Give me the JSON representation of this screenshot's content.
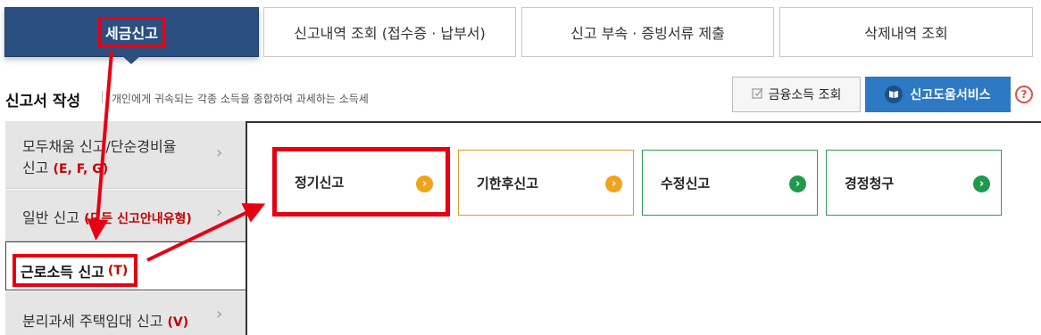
{
  "tabs": [
    {
      "label": "세금신고",
      "active": true
    },
    {
      "label": "신고내역 조회 (접수증 · 납부서)"
    },
    {
      "label": "신고 부속 · 증빙서류 제출"
    },
    {
      "label": "삭제내역 조회"
    }
  ],
  "heading": {
    "title": "신고서 작성",
    "description": "개인에게 귀속되는 각종 소득을 종합하여 과세하는 소득세"
  },
  "buttons": {
    "financial_income": "금융소득 조회",
    "help_service": "신고도움서비스",
    "help_question": "?"
  },
  "sidebar": {
    "items": [
      {
        "label_line1": "모두채움 신고/단순경비율",
        "label_line2": "신고",
        "tag": "(E, F, G)"
      },
      {
        "label": "일반 신고",
        "tag": "(모든 신고안내유형)"
      },
      {
        "label": "근로소득 신고",
        "tag": "(T)",
        "active": true
      },
      {
        "label": "분리과세 주택임대 신고",
        "tag": "(V)"
      }
    ]
  },
  "cards": [
    {
      "label": "정기신고",
      "color": "#f0a31b",
      "highlighted": true
    },
    {
      "label": "기한후신고",
      "color": "#f0a31b"
    },
    {
      "label": "수정신고",
      "color": "#1f9a4d"
    },
    {
      "label": "경정청구",
      "color": "#1f9a4d"
    }
  ],
  "colors": {
    "active_tab": "#2a4f80",
    "highlight": "#e60012",
    "help_button": "#2e79c3"
  }
}
